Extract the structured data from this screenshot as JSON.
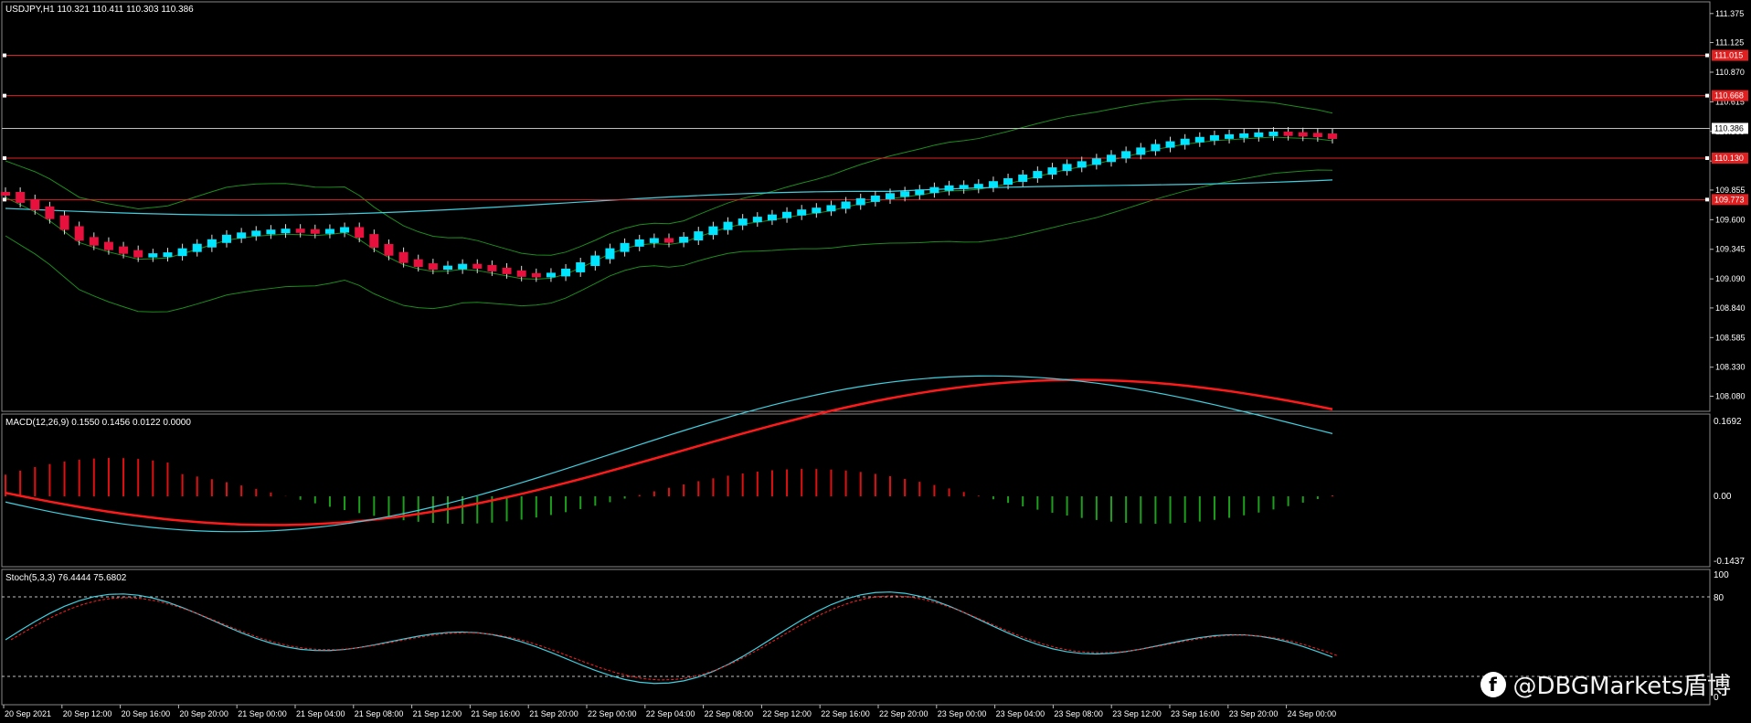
{
  "main": {
    "symbol_line": "USDJPY,H1  110.321 110.411 110.303 110.386",
    "price_labels": [
      "111.375",
      "111.125",
      "110.870",
      "110.615",
      "110.360",
      "110.105",
      "109.855",
      "109.600",
      "109.345",
      "109.090",
      "108.840",
      "108.585",
      "108.330",
      "108.080"
    ],
    "hlines": [
      {
        "price": 111.015,
        "label": "111.015",
        "color": "#e02020"
      },
      {
        "price": 110.668,
        "label": "110.668",
        "color": "#e02020"
      },
      {
        "price": 110.386,
        "label": "110.386",
        "color": "#bfbfbf",
        "current": true
      },
      {
        "price": 110.13,
        "label": "110.130",
        "color": "#e02020"
      },
      {
        "price": 109.773,
        "label": "109.773",
        "color": "#e02020"
      }
    ]
  },
  "macd": {
    "label": "MACD(12,26,9) 0.1550 0.1456 0.0122 0.0000",
    "scale": [
      "0.1692",
      "0.00",
      "-0.1437"
    ]
  },
  "stoch": {
    "label": "Stoch(5,3,3) 76.4444 75.6802",
    "scale": [
      "100",
      "80",
      "0"
    ]
  },
  "time_labels": [
    "20 Sep 2021",
    "20 Sep 12:00",
    "20 Sep 16:00",
    "20 Sep 20:00",
    "21 Sep 00:00",
    "21 Sep 04:00",
    "21 Sep 08:00",
    "21 Sep 12:00",
    "21 Sep 16:00",
    "21 Sep 20:00",
    "22 Sep 00:00",
    "22 Sep 04:00",
    "22 Sep 08:00",
    "22 Sep 12:00",
    "22 Sep 16:00",
    "22 Sep 20:00",
    "23 Sep 00:00",
    "23 Sep 04:00",
    "23 Sep 08:00",
    "23 Sep 12:00",
    "23 Sep 16:00",
    "23 Sep 20:00",
    "24 Sep 00:00"
  ],
  "watermark": {
    "logo": "f",
    "text": "@DBGMarkets盾博"
  },
  "colors": {
    "bull": "#00e5ff",
    "bear": "#e8103c",
    "band": "#1c8c1c",
    "ma": "#3fd0e0",
    "macd_main": "#3fd0e0",
    "macd_signal": "#ff1a1a"
  }
}
